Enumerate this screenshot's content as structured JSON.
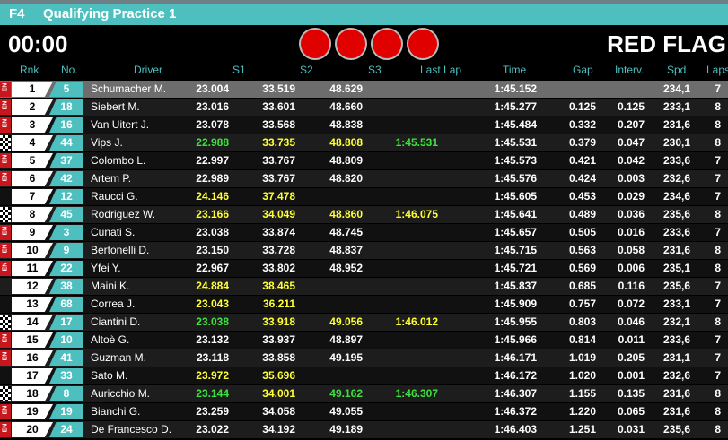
{
  "header": {
    "series": "F4",
    "session": "Qualifying Practice 1",
    "clock": "00:00",
    "status": "RED FLAG",
    "light_color": "#e00000",
    "light_count": 4
  },
  "columns": {
    "rnk": "Rnk",
    "no": "No.",
    "driver": "Driver",
    "s1": "S1",
    "s2": "S2",
    "s3": "S3",
    "last_lap": "Last Lap",
    "time": "Time",
    "gap": "Gap",
    "interv": "Interv.",
    "spd": "Spd",
    "laps": "Laps"
  },
  "colors": {
    "accent": "#4dbfbf",
    "personal_best": "#ffff33",
    "overall_best": "#3ee23e",
    "marker_red": "#c8161d"
  },
  "rows": [
    {
      "marker": "red-icon",
      "rnk": "1",
      "no": "5",
      "driver": "Schumacher M.",
      "s1": "23.004",
      "s1c": "white",
      "s2": "33.519",
      "s2c": "white",
      "s3": "48.629",
      "s3c": "white",
      "last": "",
      "lastc": "white",
      "time": "1:45.152",
      "gap": "",
      "interv": "",
      "spd": "234,1",
      "laps": "7"
    },
    {
      "marker": "red-icon",
      "rnk": "2",
      "no": "18",
      "driver": "Siebert M.",
      "s1": "23.016",
      "s1c": "white",
      "s2": "33.601",
      "s2c": "white",
      "s3": "48.660",
      "s3c": "white",
      "last": "",
      "lastc": "white",
      "time": "1:45.277",
      "gap": "0.125",
      "interv": "0.125",
      "spd": "233,1",
      "laps": "8"
    },
    {
      "marker": "red-icon",
      "rnk": "3",
      "no": "16",
      "driver": "Van Uitert J.",
      "s1": "23.078",
      "s1c": "white",
      "s2": "33.568",
      "s2c": "white",
      "s3": "48.838",
      "s3c": "white",
      "last": "",
      "lastc": "white",
      "time": "1:45.484",
      "gap": "0.332",
      "interv": "0.207",
      "spd": "231,6",
      "laps": "8"
    },
    {
      "marker": "checkered-flag-icon",
      "rnk": "4",
      "no": "44",
      "driver": "Vips J.",
      "s1": "22.988",
      "s1c": "green",
      "s2": "33.735",
      "s2c": "yellow",
      "s3": "48.808",
      "s3c": "yellow",
      "last": "1:45.531",
      "lastc": "green",
      "time": "1:45.531",
      "gap": "0.379",
      "interv": "0.047",
      "spd": "230,1",
      "laps": "8"
    },
    {
      "marker": "red-icon",
      "rnk": "5",
      "no": "37",
      "driver": "Colombo L.",
      "s1": "22.997",
      "s1c": "white",
      "s2": "33.767",
      "s2c": "white",
      "s3": "48.809",
      "s3c": "white",
      "last": "",
      "lastc": "white",
      "time": "1:45.573",
      "gap": "0.421",
      "interv": "0.042",
      "spd": "233,6",
      "laps": "7"
    },
    {
      "marker": "red-icon",
      "rnk": "6",
      "no": "42",
      "driver": "Artem P.",
      "s1": "22.989",
      "s1c": "white",
      "s2": "33.767",
      "s2c": "white",
      "s3": "48.820",
      "s3c": "white",
      "last": "",
      "lastc": "white",
      "time": "1:45.576",
      "gap": "0.424",
      "interv": "0.003",
      "spd": "232,6",
      "laps": "7"
    },
    {
      "marker": "none",
      "rnk": "7",
      "no": "12",
      "driver": "Raucci G.",
      "s1": "24.146",
      "s1c": "yellow",
      "s2": "37.478",
      "s2c": "yellow",
      "s3": "",
      "s3c": "white",
      "last": "",
      "lastc": "white",
      "time": "1:45.605",
      "gap": "0.453",
      "interv": "0.029",
      "spd": "234,6",
      "laps": "7"
    },
    {
      "marker": "checkered-flag-icon",
      "rnk": "8",
      "no": "45",
      "driver": "Rodriguez W.",
      "s1": "23.166",
      "s1c": "yellow",
      "s2": "34.049",
      "s2c": "yellow",
      "s3": "48.860",
      "s3c": "yellow",
      "last": "1:46.075",
      "lastc": "yellow",
      "time": "1:45.641",
      "gap": "0.489",
      "interv": "0.036",
      "spd": "235,6",
      "laps": "8"
    },
    {
      "marker": "red-icon",
      "rnk": "9",
      "no": "3",
      "driver": "Cunati S.",
      "s1": "23.038",
      "s1c": "white",
      "s2": "33.874",
      "s2c": "white",
      "s3": "48.745",
      "s3c": "white",
      "last": "",
      "lastc": "white",
      "time": "1:45.657",
      "gap": "0.505",
      "interv": "0.016",
      "spd": "233,6",
      "laps": "7"
    },
    {
      "marker": "red-icon",
      "rnk": "10",
      "no": "9",
      "driver": "Bertonelli D.",
      "s1": "23.150",
      "s1c": "white",
      "s2": "33.728",
      "s2c": "white",
      "s3": "48.837",
      "s3c": "white",
      "last": "",
      "lastc": "white",
      "time": "1:45.715",
      "gap": "0.563",
      "interv": "0.058",
      "spd": "231,6",
      "laps": "8"
    },
    {
      "marker": "red-icon",
      "rnk": "11",
      "no": "22",
      "driver": "Yfei Y.",
      "s1": "22.967",
      "s1c": "white",
      "s2": "33.802",
      "s2c": "white",
      "s3": "48.952",
      "s3c": "white",
      "last": "",
      "lastc": "white",
      "time": "1:45.721",
      "gap": "0.569",
      "interv": "0.006",
      "spd": "235,1",
      "laps": "8"
    },
    {
      "marker": "none",
      "rnk": "12",
      "no": "38",
      "driver": "Maini K.",
      "s1": "24.884",
      "s1c": "yellow",
      "s2": "38.465",
      "s2c": "yellow",
      "s3": "",
      "s3c": "white",
      "last": "",
      "lastc": "white",
      "time": "1:45.837",
      "gap": "0.685",
      "interv": "0.116",
      "spd": "235,6",
      "laps": "7"
    },
    {
      "marker": "none",
      "rnk": "13",
      "no": "68",
      "driver": "Correa J.",
      "s1": "23.043",
      "s1c": "yellow",
      "s2": "36.211",
      "s2c": "yellow",
      "s3": "",
      "s3c": "white",
      "last": "",
      "lastc": "white",
      "time": "1:45.909",
      "gap": "0.757",
      "interv": "0.072",
      "spd": "233,1",
      "laps": "7"
    },
    {
      "marker": "checkered-flag-icon",
      "rnk": "14",
      "no": "17",
      "driver": "Ciantini D.",
      "s1": "23.038",
      "s1c": "green",
      "s2": "33.918",
      "s2c": "yellow",
      "s3": "49.056",
      "s3c": "yellow",
      "last": "1:46.012",
      "lastc": "yellow",
      "time": "1:45.955",
      "gap": "0.803",
      "interv": "0.046",
      "spd": "232,1",
      "laps": "8"
    },
    {
      "marker": "red-icon",
      "rnk": "15",
      "no": "10",
      "driver": "Altoè G.",
      "s1": "23.132",
      "s1c": "white",
      "s2": "33.937",
      "s2c": "white",
      "s3": "48.897",
      "s3c": "white",
      "last": "",
      "lastc": "white",
      "time": "1:45.966",
      "gap": "0.814",
      "interv": "0.011",
      "spd": "233,6",
      "laps": "7"
    },
    {
      "marker": "red-icon",
      "rnk": "16",
      "no": "41",
      "driver": "Guzman M.",
      "s1": "23.118",
      "s1c": "white",
      "s2": "33.858",
      "s2c": "white",
      "s3": "49.195",
      "s3c": "white",
      "last": "",
      "lastc": "white",
      "time": "1:46.171",
      "gap": "1.019",
      "interv": "0.205",
      "spd": "231,1",
      "laps": "7"
    },
    {
      "marker": "none",
      "rnk": "17",
      "no": "33",
      "driver": "Sato M.",
      "s1": "23.972",
      "s1c": "yellow",
      "s2": "35.696",
      "s2c": "yellow",
      "s3": "",
      "s3c": "white",
      "last": "",
      "lastc": "white",
      "time": "1:46.172",
      "gap": "1.020",
      "interv": "0.001",
      "spd": "232,6",
      "laps": "7"
    },
    {
      "marker": "checkered-flag-icon",
      "rnk": "18",
      "no": "8",
      "driver": "Auricchio M.",
      "s1": "23.144",
      "s1c": "green",
      "s2": "34.001",
      "s2c": "yellow",
      "s3": "49.162",
      "s3c": "green",
      "last": "1:46.307",
      "lastc": "green",
      "time": "1:46.307",
      "gap": "1.155",
      "interv": "0.135",
      "spd": "231,6",
      "laps": "8"
    },
    {
      "marker": "red-icon",
      "rnk": "19",
      "no": "19",
      "driver": "Bianchi G.",
      "s1": "23.259",
      "s1c": "white",
      "s2": "34.058",
      "s2c": "white",
      "s3": "49.055",
      "s3c": "white",
      "last": "",
      "lastc": "white",
      "time": "1:46.372",
      "gap": "1.220",
      "interv": "0.065",
      "spd": "231,6",
      "laps": "8"
    },
    {
      "marker": "red-icon",
      "rnk": "20",
      "no": "24",
      "driver": "De Francesco D.",
      "s1": "23.022",
      "s1c": "white",
      "s2": "34.192",
      "s2c": "white",
      "s3": "49.189",
      "s3c": "white",
      "last": "",
      "lastc": "white",
      "time": "1:46.403",
      "gap": "1.251",
      "interv": "0.031",
      "spd": "235,6",
      "laps": "8"
    }
  ]
}
